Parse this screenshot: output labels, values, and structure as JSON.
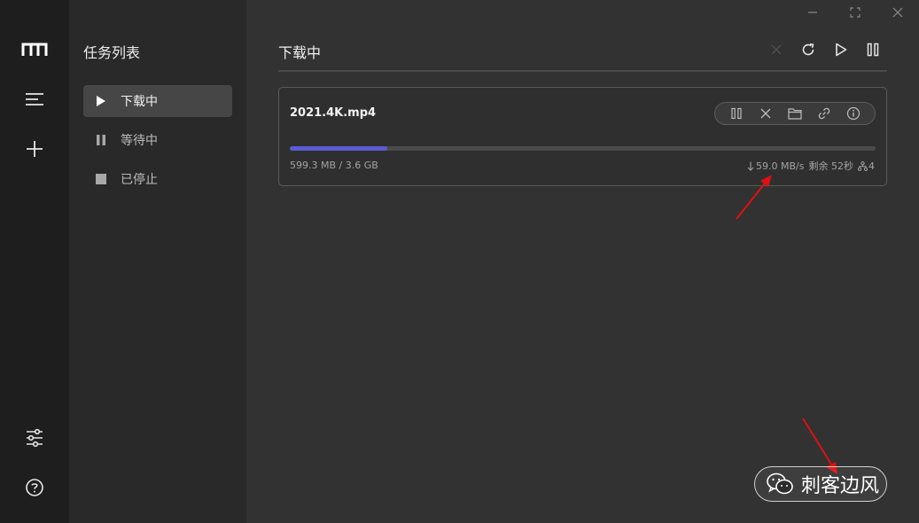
{
  "rail": {
    "icons": [
      "logo-icon",
      "menu-icon",
      "add-icon",
      "settings-sliders-icon",
      "help-icon"
    ]
  },
  "sidebar": {
    "title": "任务列表",
    "items": [
      {
        "label": "下载中",
        "icon": "play-icon",
        "active": true
      },
      {
        "label": "等待中",
        "icon": "pause-icon",
        "active": false
      },
      {
        "label": "已停止",
        "icon": "stop-icon",
        "active": false
      }
    ]
  },
  "main": {
    "title": "下载中",
    "toolbar": [
      "close-icon",
      "refresh-icon",
      "play-icon",
      "pause-icon"
    ]
  },
  "task": {
    "filename": "2021.4K.mp4",
    "size": "599.3 MB / 3.6 GB",
    "progress_fraction": 0.166,
    "speed": "59.0 MB/s",
    "remaining": "剩余 52秒",
    "connections": "4",
    "actions": [
      "pause-icon",
      "close-icon",
      "folder-icon",
      "link-icon",
      "info-icon"
    ]
  },
  "watermark": {
    "text": "刺客边风"
  },
  "colors": {
    "accent": "#5b5bd6",
    "annotation_arrow": "#e01010"
  }
}
